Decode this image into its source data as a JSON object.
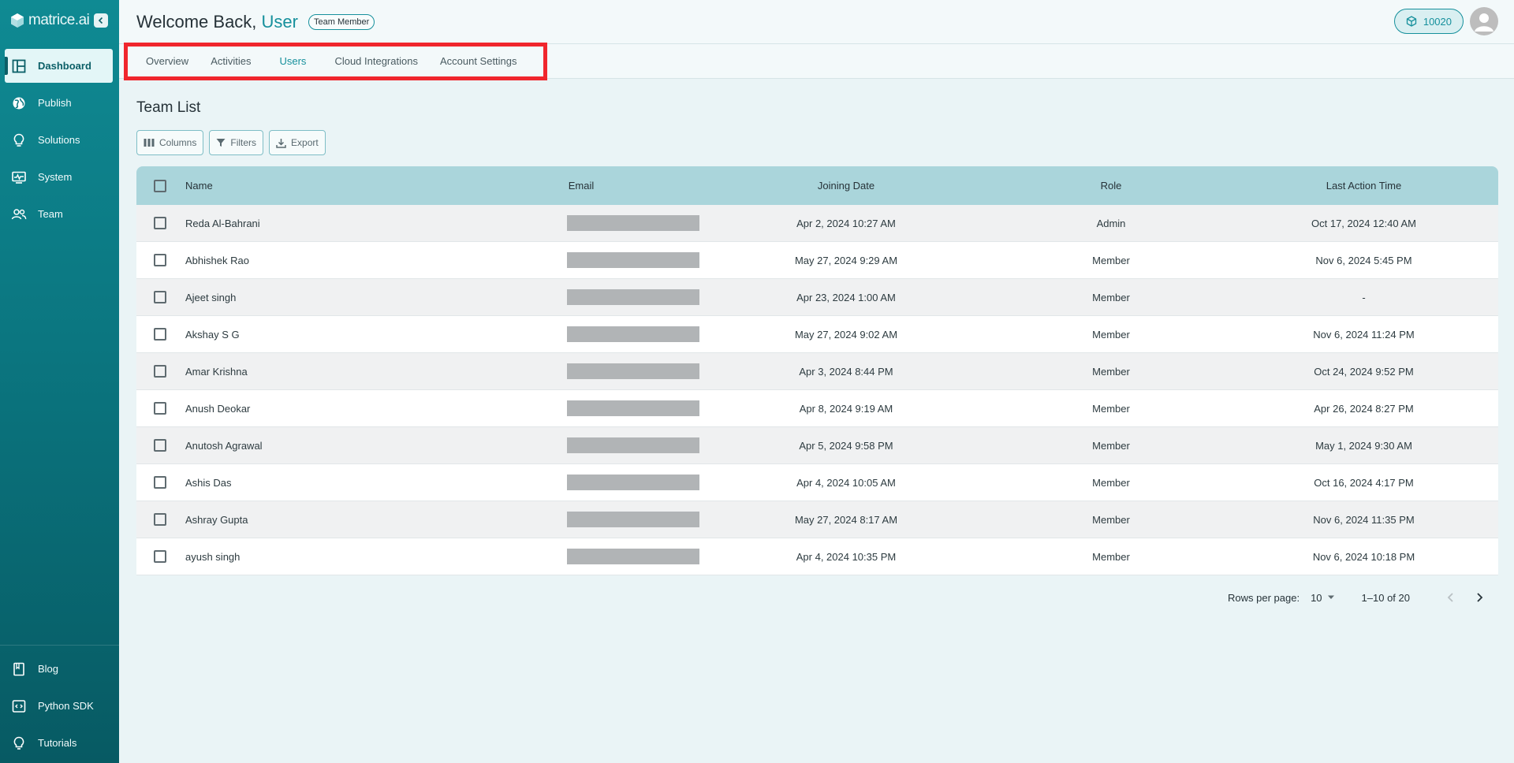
{
  "sidebar": {
    "logo_text": "matrice.ai",
    "items": [
      {
        "label": "Dashboard",
        "icon": "dashboard-icon",
        "active": true
      },
      {
        "label": "Publish",
        "icon": "globe-icon"
      },
      {
        "label": "Solutions",
        "icon": "lightbulb-icon"
      },
      {
        "label": "System",
        "icon": "monitor-icon"
      },
      {
        "label": "Team",
        "icon": "people-icon"
      }
    ],
    "bottom_items": [
      {
        "label": "Blog",
        "icon": "book-icon"
      },
      {
        "label": "Python SDK",
        "icon": "code-icon"
      },
      {
        "label": "Tutorials",
        "icon": "lightbulb-outline-icon"
      }
    ]
  },
  "header": {
    "welcome_prefix": "Welcome Back,",
    "user_name": "User",
    "role_chip": "Team Member",
    "credits": "10020"
  },
  "tabs": [
    {
      "label": "Overview"
    },
    {
      "label": "Activities"
    },
    {
      "label": "Users",
      "active": true
    },
    {
      "label": "Cloud Integrations"
    },
    {
      "label": "Account Settings"
    }
  ],
  "main": {
    "title": "Team List",
    "toolbar": {
      "columns": "Columns",
      "filters": "Filters",
      "export": "Export"
    },
    "columns": [
      "Name",
      "Email",
      "Joining Date",
      "Role",
      "Last Action Time"
    ],
    "rows": [
      {
        "name": "Reda Al-Bahrani",
        "joining": "Apr 2, 2024 10:27 AM",
        "role": "Admin",
        "last_action": "Oct 17, 2024 12:40 AM"
      },
      {
        "name": "Abhishek Rao",
        "joining": "May 27, 2024 9:29 AM",
        "role": "Member",
        "last_action": "Nov 6, 2024 5:45 PM"
      },
      {
        "name": "Ajeet singh",
        "joining": "Apr 23, 2024 1:00 AM",
        "role": "Member",
        "last_action": "-"
      },
      {
        "name": "Akshay S G",
        "joining": "May 27, 2024 9:02 AM",
        "role": "Member",
        "last_action": "Nov 6, 2024 11:24 PM"
      },
      {
        "name": "Amar Krishna",
        "joining": "Apr 3, 2024 8:44 PM",
        "role": "Member",
        "last_action": "Oct 24, 2024 9:52 PM"
      },
      {
        "name": "Anush Deokar",
        "joining": "Apr 8, 2024 9:19 AM",
        "role": "Member",
        "last_action": "Apr 26, 2024 8:27 PM"
      },
      {
        "name": "Anutosh Agrawal",
        "joining": "Apr 5, 2024 9:58 PM",
        "role": "Member",
        "last_action": "May 1, 2024 9:30 AM"
      },
      {
        "name": "Ashis Das",
        "joining": "Apr 4, 2024 10:05 AM",
        "role": "Member",
        "last_action": "Oct 16, 2024 4:17 PM"
      },
      {
        "name": "Ashray Gupta",
        "joining": "May 27, 2024 8:17 AM",
        "role": "Member",
        "last_action": "Nov 6, 2024 11:35 PM"
      },
      {
        "name": "ayush singh",
        "joining": "Apr 4, 2024 10:35 PM",
        "role": "Member",
        "last_action": "Nov 6, 2024 10:18 PM"
      }
    ],
    "pagination": {
      "rows_label": "Rows per page:",
      "rows_value": "10",
      "range": "1–10 of 20"
    }
  },
  "colors": {
    "accent": "#16909c",
    "sidebar": "#0b7680",
    "header_row": "#aad5db",
    "highlight": "#f0262d"
  }
}
